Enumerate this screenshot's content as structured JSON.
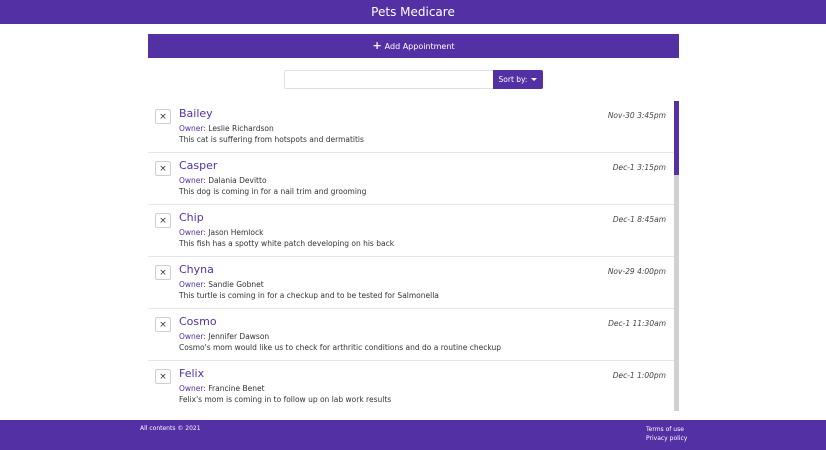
{
  "header": {
    "title": "Pets Medicare"
  },
  "add_button": {
    "icon": "plus-icon",
    "label": "Add Appointment"
  },
  "search": {
    "value": "",
    "placeholder": "",
    "sort_label": "Sort by:"
  },
  "appointments": [
    {
      "pet": "Bailey",
      "owner_label": "Owner:",
      "owner": "Leslie Richardson",
      "notes": "This cat is suffering from hotspots and dermatitis",
      "date": "Nov-30 3:45pm"
    },
    {
      "pet": "Casper",
      "owner_label": "Owner:",
      "owner": "Dalania Devitto",
      "notes": "This dog is coming in for a nail trim and grooming",
      "date": "Dec-1 3:15pm"
    },
    {
      "pet": "Chip",
      "owner_label": "Owner:",
      "owner": "Jason Hemlock",
      "notes": "This fish has a spotty white patch developing on his back",
      "date": "Dec-1 8:45am"
    },
    {
      "pet": "Chyna",
      "owner_label": "Owner:",
      "owner": "Sandie Gobnet",
      "notes": "This turtle is coming in for a checkup and to be tested for Salmonella",
      "date": "Nov-29 4:00pm"
    },
    {
      "pet": "Cosmo",
      "owner_label": "Owner:",
      "owner": "Jennifer Dawson",
      "notes": "Cosmo's mom would like us to check for arthritic conditions and do a routine checkup",
      "date": "Dec-1 11:30am"
    },
    {
      "pet": "Felix",
      "owner_label": "Owner:",
      "owner": "Francine Benet",
      "notes": "Felix's mom is coming in to follow up on lab work results",
      "date": "Dec-1 1:00pm"
    }
  ],
  "delete_symbol": "×",
  "footer": {
    "copyright": "All contents © 2021",
    "terms": "Terms of use",
    "privacy": "Privacy policy"
  },
  "colors": {
    "brand": "#5430a5"
  }
}
